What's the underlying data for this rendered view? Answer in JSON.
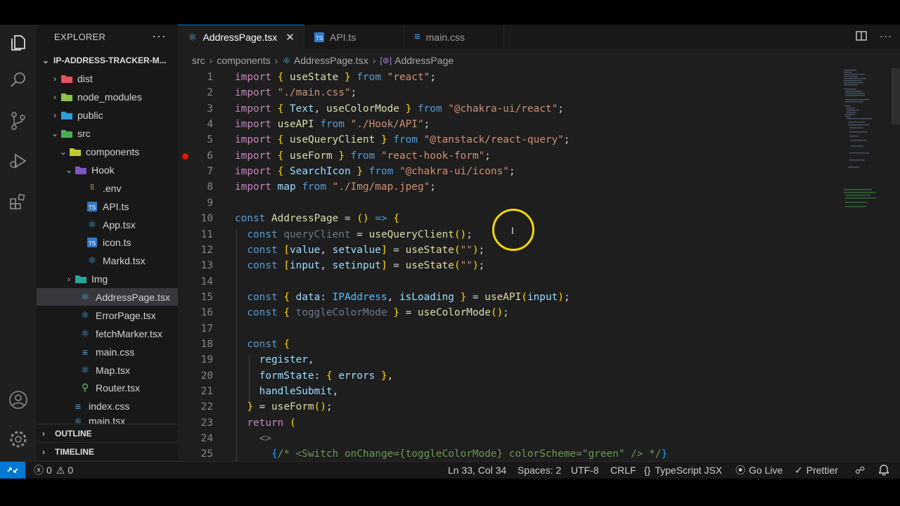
{
  "sidebar": {
    "title": "EXPLORER",
    "project": "IP-ADDRESS-TRACKER-M...",
    "items": [
      {
        "label": "dist",
        "icon": "folder-dist-icon"
      },
      {
        "label": "node_modules",
        "icon": "folder-node-icon"
      },
      {
        "label": "public",
        "icon": "folder-public-icon"
      },
      {
        "label": "src",
        "icon": "folder-src-icon"
      },
      {
        "label": "components",
        "icon": "folder-components-icon"
      },
      {
        "label": "Hook",
        "icon": "folder-hook-icon"
      },
      {
        "label": ".env",
        "icon": "env-file-icon"
      },
      {
        "label": "API.ts",
        "icon": "ts-file-icon"
      },
      {
        "label": "App.tsx",
        "icon": "react-file-icon"
      },
      {
        "label": "icon.ts",
        "icon": "ts-file-icon"
      },
      {
        "label": "Markd.tsx",
        "icon": "react-file-icon"
      },
      {
        "label": "Img",
        "icon": "folder-img-icon"
      },
      {
        "label": "AddressPage.tsx",
        "icon": "react-file-icon"
      },
      {
        "label": "ErrorPage.tsx",
        "icon": "react-file-icon"
      },
      {
        "label": "fetchMarker.tsx",
        "icon": "react-file-icon"
      },
      {
        "label": "main.css",
        "icon": "css-file-icon"
      },
      {
        "label": "Map.tsx",
        "icon": "react-file-icon"
      },
      {
        "label": "Router.tsx",
        "icon": "router-file-icon"
      },
      {
        "label": "index.css",
        "icon": "css-file-icon"
      },
      {
        "label": "main.tsx",
        "icon": "react-file-icon"
      }
    ],
    "outline": "OUTLINE",
    "timeline": "TIMELINE"
  },
  "tabs": [
    {
      "label": "AddressPage.tsx",
      "icon": "react-file-icon",
      "active": true
    },
    {
      "label": "API.ts",
      "icon": "ts-file-icon",
      "active": false
    },
    {
      "label": "main.css",
      "icon": "css-file-icon",
      "active": false
    }
  ],
  "breadcrumb": [
    "src",
    "components",
    "AddressPage.tsx",
    "AddressPage"
  ],
  "code_lines": [
    "import { useState } from \"react\";",
    "import \"./main.css\";",
    "import { Text, useColorMode } from \"@chakra-ui/react\";",
    "import useAPI from \"./Hook/API\";",
    "import { useQueryClient } from \"@tanstack/react-query\";",
    "import { useForm } from \"react-hook-form\";",
    "import { SearchIcon } from \"@chakra-ui/icons\";",
    "import map from \"./Img/map.jpeg\";",
    "",
    "const AddressPage = () => {",
    "  const queryClient = useQueryClient();",
    "  const [value, setvalue] = useState(\"\");",
    "  const [input, setinput] = useState(\"\");",
    "",
    "  const { data: IPAddress, isLoading } = useAPI(input);",
    "  const { toggleColorMode } = useColorMode();",
    "",
    "  const {",
    "    register,",
    "    formState: { errors },",
    "    handleSubmit,",
    "  } = useForm();",
    "  return (",
    "    <>",
    "      {/* <Switch onChange={toggleColorMode} colorScheme=\"green\" /> */}"
  ],
  "status": {
    "errors": "0",
    "warnings": "0",
    "position": "Ln 33, Col 34",
    "spaces": "Spaces: 2",
    "encoding": "UTF-8",
    "eol": "CRLF",
    "language": "TypeScript JSX",
    "golive": "Go Live",
    "prettier": "Prettier"
  },
  "colors": {
    "accent": "#0078d4",
    "breakpoint": "#e51400",
    "cursor_highlight": "#f1d80a"
  }
}
